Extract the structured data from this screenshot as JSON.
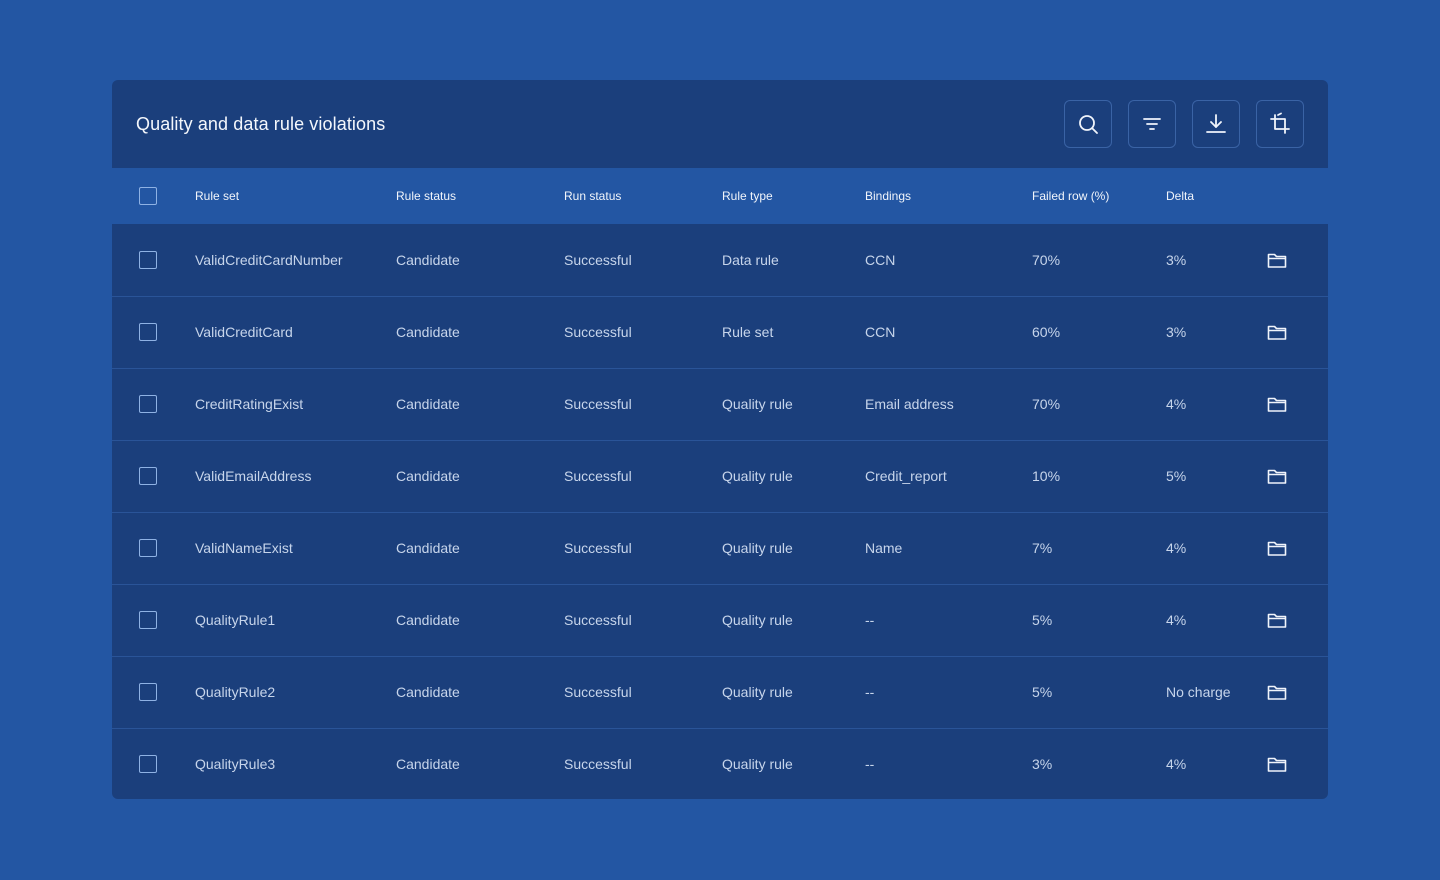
{
  "card": {
    "title": "Quality and data rule violations",
    "toolbar": [
      {
        "name": "search-button",
        "icon": "search-icon"
      },
      {
        "name": "filter-button",
        "icon": "filter-icon"
      },
      {
        "name": "download-button",
        "icon": "download-icon"
      },
      {
        "name": "crop-button",
        "icon": "crop-icon"
      }
    ]
  },
  "table": {
    "columns": [
      "Rule set",
      "Rule status",
      "Run status",
      "Rule type",
      "Bindings",
      "Failed row (%)",
      "Delta"
    ],
    "rows": [
      {
        "rule_set": "ValidCreditCardNumber",
        "rule_status": "Candidate",
        "run_status": "Successful",
        "rule_type": "Data rule",
        "bindings": "CCN",
        "failed_row": "70%",
        "delta": "3%"
      },
      {
        "rule_set": "ValidCreditCard",
        "rule_status": "Candidate",
        "run_status": "Successful",
        "rule_type": "Rule set",
        "bindings": "CCN",
        "failed_row": "60%",
        "delta": "3%"
      },
      {
        "rule_set": "CreditRatingExist",
        "rule_status": "Candidate",
        "run_status": "Successful",
        "rule_type": "Quality rule",
        "bindings": "Email address",
        "failed_row": "70%",
        "delta": "4%"
      },
      {
        "rule_set": "ValidEmailAddress",
        "rule_status": "Candidate",
        "run_status": "Successful",
        "rule_type": "Quality rule",
        "bindings": "Credit_report",
        "failed_row": "10%",
        "delta": "5%"
      },
      {
        "rule_set": "ValidNameExist",
        "rule_status": "Candidate",
        "run_status": "Successful",
        "rule_type": "Quality rule",
        "bindings": "Name",
        "failed_row": "7%",
        "delta": "4%"
      },
      {
        "rule_set": "QualityRule1",
        "rule_status": "Candidate",
        "run_status": "Successful",
        "rule_type": "Quality rule",
        "bindings": "--",
        "failed_row": "5%",
        "delta": "4%"
      },
      {
        "rule_set": "QualityRule2",
        "rule_status": "Candidate",
        "run_status": "Successful",
        "rule_type": "Quality rule",
        "bindings": "--",
        "failed_row": "5%",
        "delta": "No charge"
      },
      {
        "rule_set": "QualityRule3",
        "rule_status": "Candidate",
        "run_status": "Successful",
        "rule_type": "Quality rule",
        "bindings": "--",
        "failed_row": "3%",
        "delta": "4%"
      }
    ]
  },
  "colors": {
    "page_background": "#2356a3",
    "card_background": "#1b3f7c",
    "header_row_background": "#2356a3",
    "checkbox_border": "#8fb2e4"
  }
}
